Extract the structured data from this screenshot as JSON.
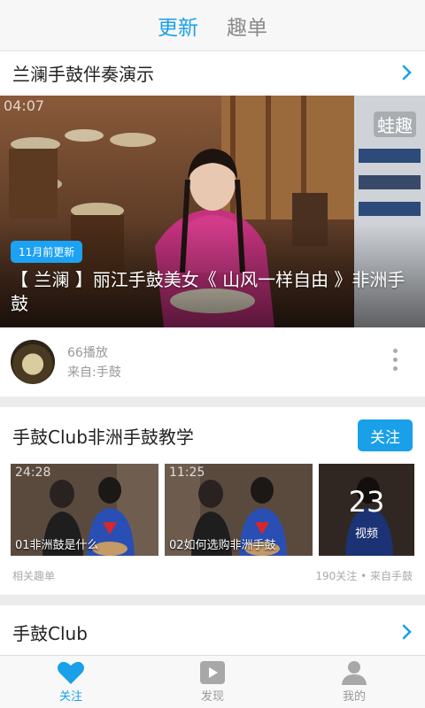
{
  "top_tabs": [
    {
      "label": "更新",
      "active": true
    },
    {
      "label": "趣单",
      "active": false
    }
  ],
  "card1": {
    "title": "兰澜手鼓伴奏演示",
    "video": {
      "duration": "04:07",
      "watermark": "蛙趣",
      "badge": "11月前更新",
      "title": "【 兰澜 】丽江手鼓美女《 山风一样自由 》非洲手鼓"
    },
    "plays": "66播放",
    "source": "来自:手鼓"
  },
  "card2": {
    "title": "手鼓Club非洲手鼓教学",
    "follow_label": "关注",
    "thumbs": [
      {
        "duration": "24:28",
        "caption": "01非洲鼓是什么"
      },
      {
        "duration": "11:25",
        "caption": "02如何选购非洲手鼓"
      }
    ],
    "count": "23",
    "count_label": "视频",
    "footer_left": "相关趣单",
    "footer_right": "190关注 • 来自手鼓"
  },
  "card3": {
    "title": "手鼓Club"
  },
  "bottom_nav": [
    {
      "label": "关注",
      "icon": "heart-icon",
      "active": true
    },
    {
      "label": "发现",
      "icon": "play-icon",
      "active": false
    },
    {
      "label": "我的",
      "icon": "person-icon",
      "active": false
    }
  ],
  "colors": {
    "accent": "#1aa0e8",
    "muted": "#999999"
  }
}
